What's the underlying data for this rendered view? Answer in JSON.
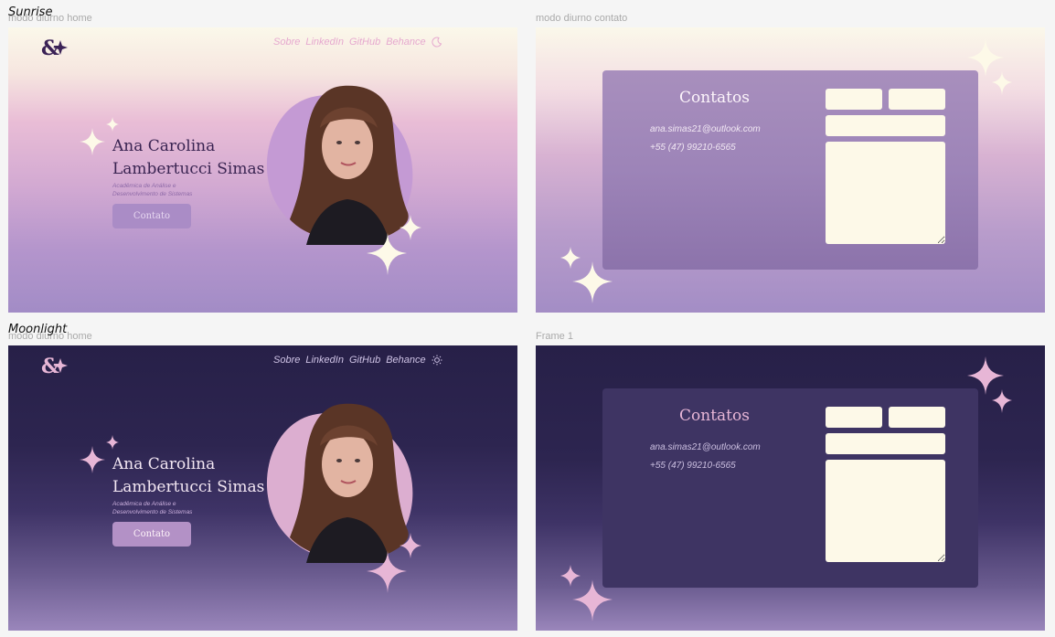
{
  "sections": {
    "sunrise": "Sunrise",
    "moonlight": "Moonlight"
  },
  "frames": {
    "sun_home": "modo diurno home",
    "sun_contact": "modo diurno contato",
    "moon_home": "modo diurno home",
    "moon_contact": "Frame 1"
  },
  "nav": {
    "items": [
      "Sobre",
      "LinkedIn",
      "GitHub",
      "Behance"
    ],
    "theme_icon": "sun-moon-icon"
  },
  "hero": {
    "name_line1": "Ana Carolina",
    "name_line2": "Lambertucci Simas",
    "subtitle_line1": "Acadêmica de Análise e",
    "subtitle_line2": "Desenvolvimento de Sistemas",
    "contact_button": "Contato"
  },
  "contact": {
    "title": "Contatos",
    "email": "ana.simas21@outlook.com",
    "phone": "+55 (47) 99210-6565"
  },
  "colors": {
    "sun_accent": "#aa8cc6",
    "moon_accent": "#b391c6",
    "moon_bg": "#272048",
    "input_bg": "#fdf9e8",
    "sparkle_sun": "#fdf9e8",
    "sparkle_moon": "#e7b6d6"
  }
}
